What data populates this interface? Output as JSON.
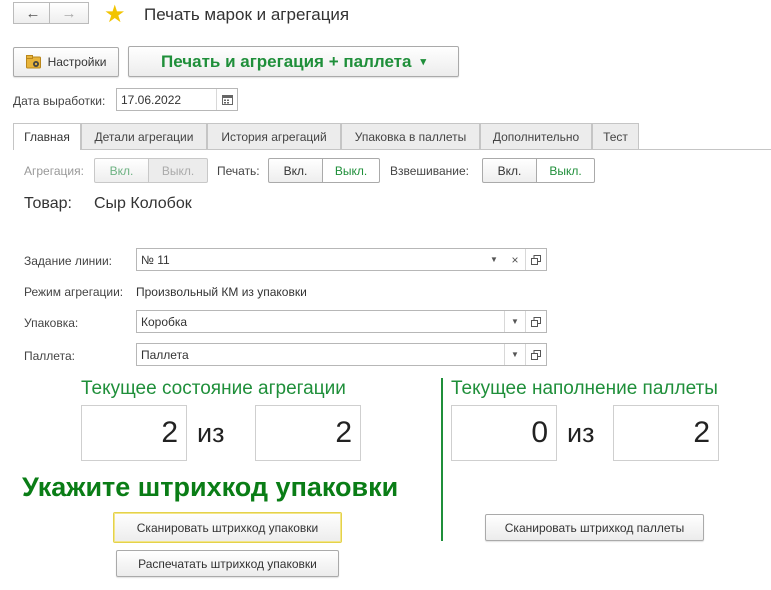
{
  "window": {
    "title": "Печать марок и агрегация",
    "back_glyph": "←",
    "forward_glyph": "→",
    "favorite_glyph": "★"
  },
  "toolbar": {
    "settings_label": "Настройки",
    "print_menu_label": "Печать и агрегация + паллета",
    "print_menu_arrow": "▾"
  },
  "production_date": {
    "label": "Дата выработки:",
    "value": "17.06.2022"
  },
  "tabs": [
    "Главная",
    "Детали агрегации",
    "История агрегаций",
    "Упаковка в паллеты",
    "Дополнительно",
    "Тест"
  ],
  "toggles": {
    "aggregation": {
      "label": "Агрегация:",
      "on": "Вкл.",
      "off": "Выкл."
    },
    "print": {
      "label": "Печать:",
      "on": "Вкл.",
      "off": "Выкл."
    },
    "weighing": {
      "label": "Взвешивание:",
      "on": "Вкл.",
      "off": "Выкл."
    }
  },
  "product": {
    "label": "Товар:",
    "value": "Сыр Колобок"
  },
  "line_task": {
    "label": "Задание линии:",
    "value": "№ 11"
  },
  "aggregation_mode": {
    "label": "Режим агрегации:",
    "value": "Произвольный КМ из упаковки"
  },
  "package": {
    "label": "Упаковка:",
    "value": "Коробка"
  },
  "pallet": {
    "label": "Паллета:",
    "value": "Паллета"
  },
  "aggregation_state": {
    "title": "Текущее состояние агрегации",
    "current": "2",
    "of": "из",
    "total": "2"
  },
  "pallet_fill": {
    "title": "Текущее наполнение паллеты",
    "current": "0",
    "of": "из",
    "total": "2"
  },
  "prompt": "Укажите штрихкод упаковки",
  "buttons": {
    "scan_package": "Сканировать штрихкод упаковки",
    "print_package": "Распечатать штрихкод упаковки",
    "scan_pallet": "Сканировать штрихкод паллеты"
  },
  "colors": {
    "green": "#1f8f3a",
    "prompt_green": "#0a7d16",
    "accent_yellow": "#f2c400"
  }
}
